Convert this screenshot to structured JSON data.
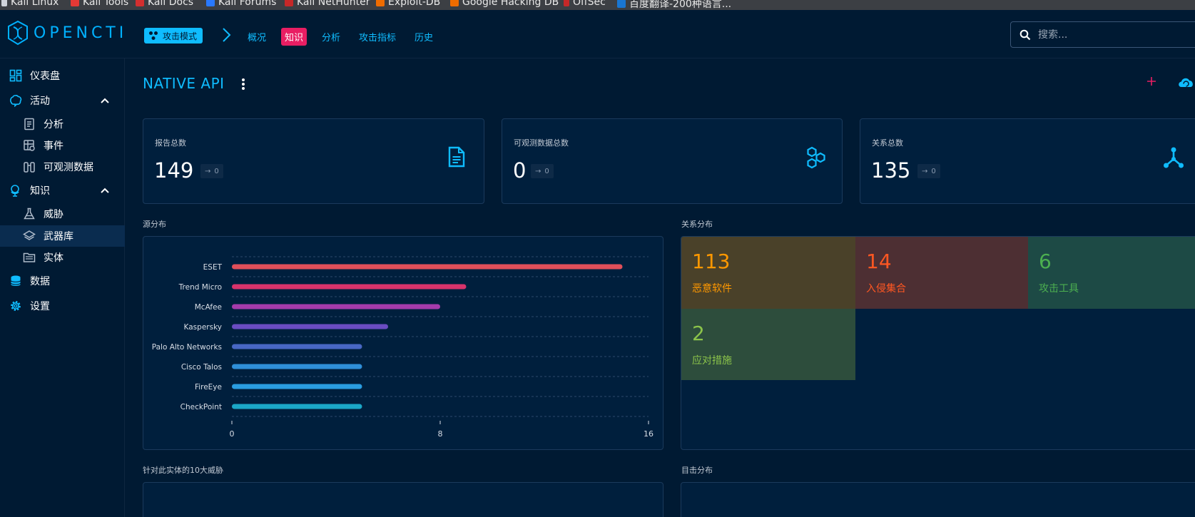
{
  "bookmarks": [
    {
      "label": "Kali Linux",
      "color": "#cfd3da"
    },
    {
      "label": "Kali Tools",
      "color": "#e53935"
    },
    {
      "label": "Kali Docs",
      "color": "#d32f2f"
    },
    {
      "label": "Kali Forums",
      "color": "#2979ff"
    },
    {
      "label": "Kali NetHunter",
      "color": "#c62828"
    },
    {
      "label": "Exploit-DB",
      "color": "#ef6c00"
    },
    {
      "label": "Google Hacking DB",
      "color": "#ef6c00"
    },
    {
      "label": "OffSec",
      "color": "#c62828"
    },
    {
      "label": "百度翻译-200种语言...",
      "color": "#1976d2"
    }
  ],
  "header": {
    "logo": "OPENCTI",
    "mode_label": "攻击模式",
    "nav": [
      "概况",
      "知识",
      "分析",
      "攻击指标",
      "历史"
    ],
    "active_nav": "知识",
    "search_placeholder": "搜索..."
  },
  "sidebar": {
    "items": [
      {
        "label": "仪表盘",
        "icon": "dashboard-icon",
        "level": 0
      },
      {
        "label": "活动",
        "icon": "activity-brain-icon",
        "level": 0,
        "expanded": true
      },
      {
        "label": "分析",
        "icon": "analysis-document-icon",
        "level": 1
      },
      {
        "label": "事件",
        "icon": "events-icon",
        "level": 1
      },
      {
        "label": "可观测数据",
        "icon": "binoculars-icon",
        "level": 1
      },
      {
        "label": "知识",
        "icon": "globe-icon",
        "level": 0,
        "expanded": true
      },
      {
        "label": "威胁",
        "icon": "flask-icon",
        "level": 1
      },
      {
        "label": "武器库",
        "icon": "layers-icon",
        "level": 1,
        "selected": true
      },
      {
        "label": "实体",
        "icon": "folder-icon",
        "level": 1
      },
      {
        "label": "数据",
        "icon": "database-icon",
        "level": 0
      },
      {
        "label": "设置",
        "icon": "gear-icon",
        "level": 0
      }
    ]
  },
  "page": {
    "title": "NATIVE API"
  },
  "cards": [
    {
      "label": "报告总数",
      "value": "149",
      "delta": "0",
      "icon": "report-document-icon"
    },
    {
      "label": "可观测数据总数",
      "value": "0",
      "delta": "0",
      "icon": "hexagons-icon"
    },
    {
      "label": "关系总数",
      "value": "135",
      "delta": "0",
      "icon": "relationship-graph-icon"
    }
  ],
  "sections": {
    "sources": "源分布",
    "relations": "关系分布",
    "top_threats": "针对此实体的10大威胁",
    "targets": "目击分布"
  },
  "chart_data": {
    "type": "bar",
    "orientation": "horizontal",
    "categories": [
      "ESET",
      "Trend Micro",
      "McAfee",
      "Kaspersky",
      "Palo Alto Networks",
      "Cisco Talos",
      "FireEye",
      "CheckPoint"
    ],
    "values": [
      15,
      9,
      8,
      6,
      5,
      5,
      5,
      5
    ],
    "colors": [
      "#e04f5a",
      "#d8336b",
      "#a53bab",
      "#6a4cc2",
      "#4867c4",
      "#2f8fd8",
      "#2a9de0",
      "#1ba7c7"
    ],
    "xticks": [
      0,
      8,
      16
    ],
    "xlim": [
      0,
      16
    ],
    "grid": true
  },
  "relation_tiles": [
    {
      "value": "113",
      "label": "恶意软件",
      "bg": "#4a4129",
      "fg": "#ff9800"
    },
    {
      "value": "14",
      "label": "入侵集合",
      "bg": "#4d2f33",
      "fg": "#ff5722"
    },
    {
      "value": "6",
      "label": "攻击工具",
      "bg": "#1d4a45",
      "fg": "#4caf50"
    },
    {
      "value": "2",
      "label": "应对措施",
      "bg": "#2d4d3c",
      "fg": "#8bc34a"
    }
  ]
}
